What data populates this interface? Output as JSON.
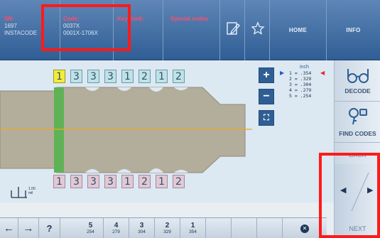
{
  "header": {
    "sn_label": "SN:",
    "sn_value": "1697",
    "instacode": "INSTACODE",
    "code_label": "Code:",
    "code_value": "0037X",
    "code_series": "0001X-1706X",
    "keyblank_label": "Keyblank:",
    "special_codes_label": "Special codes",
    "home_label": "HOME",
    "info_label": "INFO"
  },
  "top_cuts": [
    "1",
    "3",
    "3",
    "3",
    "1",
    "2",
    "1",
    "2"
  ],
  "bottom_cuts": [
    "1",
    "3",
    "3",
    "3",
    "1",
    "2",
    "1",
    "2"
  ],
  "depth_panel": {
    "unit": "inch",
    "depths": [
      "1 = .354",
      "2 = .329",
      "3 = .304",
      "4 = .279",
      "5 = .254"
    ]
  },
  "right_buttons": {
    "decode": "DECODE",
    "find_codes": "FIND CODES",
    "back": "BACK",
    "next": "NEXT"
  },
  "bottom_bar": {
    "help": "?",
    "depth_buttons": [
      {
        "num": "5",
        "val": "254"
      },
      {
        "num": "4",
        "val": "279"
      },
      {
        "num": "3",
        "val": "304"
      },
      {
        "num": "2",
        "val": "329"
      },
      {
        "num": "1",
        "val": "354"
      }
    ]
  },
  "scale_label": "1.00\nmil",
  "colors": {
    "header_bg": "#2f5e95",
    "highlight": "#ff1a1a",
    "key_body": "#b3ae9c",
    "shoulder": "#5fb255",
    "center_line": "#e9a91f"
  }
}
